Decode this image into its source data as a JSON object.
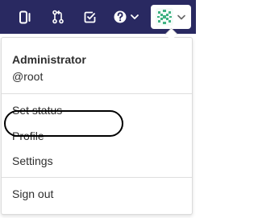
{
  "colors": {
    "topbar_bg": "#292961",
    "nav_icon": "#ffffff",
    "avatar_pattern": "#3fb283",
    "text": "#2e2e2e",
    "divider": "#dedede",
    "highlight_ring": "#000000"
  },
  "topbar": {
    "icons": [
      "sidebar-panel-icon",
      "merge-request-icon",
      "todo-checkbox-icon",
      "help-question-icon",
      "chevron-down-icon"
    ],
    "avatar_icon": "identicon-avatar-icon"
  },
  "dropdown": {
    "user": {
      "name": "Administrator",
      "handle": "@root"
    },
    "items": [
      {
        "label": "Set status"
      },
      {
        "label": "Profile"
      },
      {
        "label": "Settings",
        "highlighted": true
      },
      {
        "label": "Sign out"
      }
    ]
  }
}
